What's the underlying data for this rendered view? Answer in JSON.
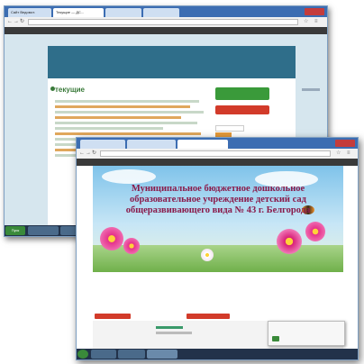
{
  "back_window": {
    "tabs": [
      "Сайт Ведомст.",
      "Текущие — ДС...",
      "",
      ""
    ],
    "url": "",
    "bookmarks": [
      "",
      "",
      "",
      "",
      "",
      ""
    ],
    "nav_rows": [
      "",
      "",
      ""
    ],
    "article": {
      "title": "текущие",
      "sidebar_green_label": "",
      "sidebar_red_label": ""
    },
    "taskbar": {
      "start": "Пуск",
      "items": [
        "",
        ""
      ]
    }
  },
  "front_window": {
    "tabs": [
      "",
      "",
      ""
    ],
    "url": "",
    "bookmarks": [
      "",
      "",
      "",
      "",
      ""
    ],
    "header": {
      "title": "Муниципальное бюджетное дошкольное образовательное учреждение детский сад общеразвивающего вида № 43 г. Белгорода",
      "address": ""
    },
    "links": [
      "",
      "",
      "",
      "",
      "",
      "",
      ""
    ],
    "buttons": {
      "left_red": "",
      "center_red": ""
    },
    "float_panel": {
      "text": ""
    },
    "taskbar": {
      "items": [
        "",
        "",
        ""
      ],
      "tray_time": "",
      "tray_date": ""
    }
  },
  "colors": {
    "accent": "#2b579a",
    "title_color": "#8a1a4a",
    "nav_bg": "#2f6e8a",
    "button_red": "#d23b2a",
    "button_green": "#3a9a3a"
  }
}
